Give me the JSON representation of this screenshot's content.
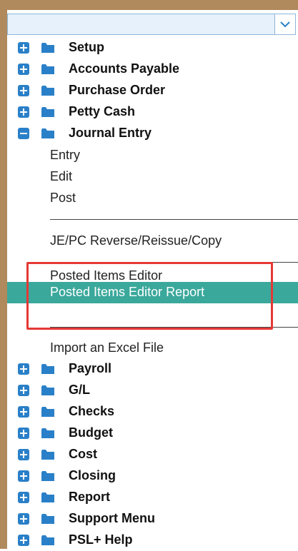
{
  "dropdown": {
    "value": ""
  },
  "colors": {
    "frame": "#b08a5d",
    "expander": "#2a80c8",
    "folder": "#2a80c8",
    "selected_bg": "#3aa89b",
    "highlight": "#e53935"
  },
  "tree": {
    "top_nodes": [
      {
        "label": "Setup",
        "state": "collapsed"
      },
      {
        "label": "Accounts Payable",
        "state": "collapsed"
      },
      {
        "label": "Purchase Order",
        "state": "collapsed"
      },
      {
        "label": "Petty Cash",
        "state": "collapsed"
      },
      {
        "label": "Journal Entry",
        "state": "expanded"
      }
    ],
    "journal_children": [
      {
        "label": "Entry"
      },
      {
        "label": "Edit"
      },
      {
        "label": "Post"
      },
      {
        "label": "JE/PC Reverse/Reissue/Copy"
      },
      {
        "label": "Posted Items Editor"
      },
      {
        "label": "Posted Items Editor Report",
        "selected": true
      },
      {
        "label": "Import an Excel File"
      }
    ],
    "bottom_nodes": [
      {
        "label": "Payroll",
        "state": "collapsed"
      },
      {
        "label": "G/L",
        "state": "collapsed"
      },
      {
        "label": "Checks",
        "state": "collapsed"
      },
      {
        "label": "Budget",
        "state": "collapsed"
      },
      {
        "label": "Cost",
        "state": "collapsed"
      },
      {
        "label": "Closing",
        "state": "collapsed"
      },
      {
        "label": "Report",
        "state": "collapsed"
      },
      {
        "label": "Support Menu",
        "state": "collapsed"
      },
      {
        "label": "PSL+ Help",
        "state": "collapsed"
      }
    ]
  }
}
